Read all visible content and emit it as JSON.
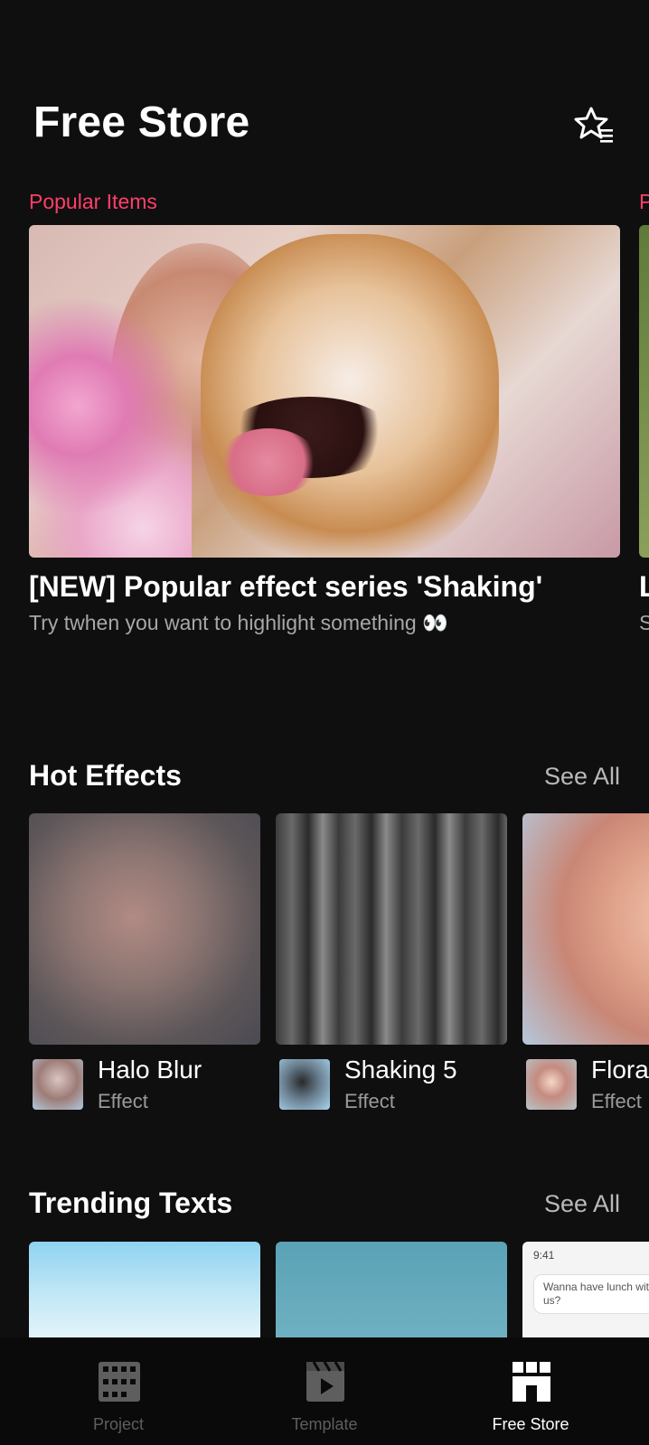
{
  "header": {
    "title": "Free Store"
  },
  "promos": [
    {
      "section": "Popular Items",
      "title": "[NEW] Popular effect series 'Shaking'",
      "subtitle": "Try twhen you want to highlight something 👀"
    },
    {
      "section": "P",
      "title": "L",
      "subtitle": "S"
    }
  ],
  "hot_effects": {
    "heading": "Hot Effects",
    "see_all": "See All",
    "items": [
      {
        "name": "Halo Blur",
        "type": "Effect"
      },
      {
        "name": "Shaking 5",
        "type": "Effect"
      },
      {
        "name": "Flora",
        "type": "Effect"
      }
    ]
  },
  "trending_texts": {
    "heading": "Trending Texts",
    "see_all": "See All",
    "preview_time": "9:41",
    "preview_message": "Wanna have lunch with us?"
  },
  "nav": {
    "items": [
      {
        "label": "Project",
        "icon": "film-grid-icon"
      },
      {
        "label": "Template",
        "icon": "clapperboard-play-icon"
      },
      {
        "label": "Free Store",
        "icon": "store-icon"
      }
    ],
    "active": "Free Store"
  },
  "colors": {
    "background": "#0f0f0f",
    "accent": "#ff3f6a",
    "muted": "#b9b9b9"
  }
}
